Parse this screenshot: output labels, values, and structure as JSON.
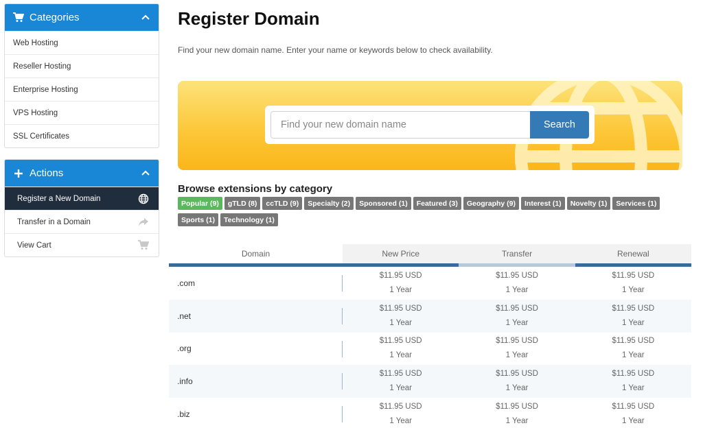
{
  "categories": {
    "title": "Categories",
    "items": [
      "Web Hosting",
      "Reseller Hosting",
      "Enterprise Hosting",
      "VPS Hosting",
      "SSL Certificates"
    ]
  },
  "actions": {
    "title": "Actions",
    "items": [
      {
        "label": "Register a New Domain",
        "icon": "globe-icon",
        "active": true
      },
      {
        "label": "Transfer in a Domain",
        "icon": "share-arrow-icon",
        "active": false
      },
      {
        "label": "View Cart",
        "icon": "cart-icon",
        "active": false
      }
    ]
  },
  "page": {
    "title": "Register Domain",
    "intro": "Find your new domain name. Enter your name or keywords below to check availability."
  },
  "search": {
    "placeholder": "Find your new domain name",
    "value": "",
    "button": "Search"
  },
  "browse": {
    "heading": "Browse extensions by category",
    "tags": [
      "Popular (9)",
      "gTLD (8)",
      "ccTLD (9)",
      "Specialty (2)",
      "Sponsored (1)",
      "Featured (3)",
      "Geography (9)",
      "Interest (1)",
      "Novelty (1)",
      "Services (1)",
      "Sports (1)",
      "Technology (1)"
    ]
  },
  "table": {
    "headers": [
      "Domain",
      "New Price",
      "Transfer",
      "Renewal"
    ],
    "rows": [
      {
        "tld": ".com",
        "new_price": "$11.95 USD",
        "new_term": "1 Year",
        "transfer_price": "$11.95 USD",
        "transfer_term": "1 Year",
        "renewal_price": "$11.95 USD",
        "renewal_term": "1 Year"
      },
      {
        "tld": ".net",
        "new_price": "$11.95 USD",
        "new_term": "1 Year",
        "transfer_price": "$11.95 USD",
        "transfer_term": "1 Year",
        "renewal_price": "$11.95 USD",
        "renewal_term": "1 Year"
      },
      {
        "tld": ".org",
        "new_price": "$11.95 USD",
        "new_term": "1 Year",
        "transfer_price": "$11.95 USD",
        "transfer_term": "1 Year",
        "renewal_price": "$11.95 USD",
        "renewal_term": "1 Year"
      },
      {
        "tld": ".info",
        "new_price": "$11.95 USD",
        "new_term": "1 Year",
        "transfer_price": "$11.95 USD",
        "transfer_term": "1 Year",
        "renewal_price": "$11.95 USD",
        "renewal_term": "1 Year"
      },
      {
        "tld": ".biz",
        "new_price": "$11.95 USD",
        "new_term": "1 Year",
        "transfer_price": "$11.95 USD",
        "transfer_term": "1 Year",
        "renewal_price": "$11.95 USD",
        "renewal_term": "1 Year"
      }
    ]
  },
  "colors": {
    "panel_header": "#1a86d6",
    "active_item": "#1f2d3d",
    "search_button": "#337ab7",
    "tag_default": "#777777",
    "tag_active": "#5cb85c",
    "header_line_dark": "#3a6a9a",
    "header_line_light": "#b8c9d9"
  }
}
